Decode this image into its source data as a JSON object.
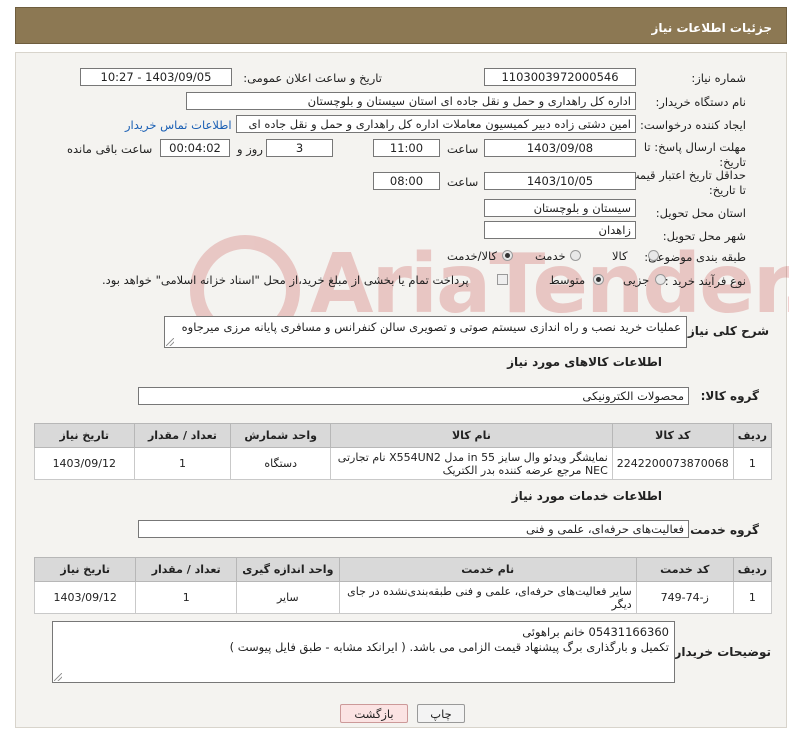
{
  "header": {
    "title": "جزئیات اطلاعات نیاز"
  },
  "form": {
    "need_number_label": "شماره نیاز:",
    "need_number": "1103003972000546",
    "announce_label": "تاریخ و ساعت اعلان عمومی:",
    "announce_value": "1403/09/05 - 10:27",
    "buyer_org_label": "نام دستگاه خریدار:",
    "buyer_org": "اداره کل راهداری و حمل و نقل جاده ای استان سیستان و بلوچستان",
    "creator_label": "ایجاد کننده درخواست:",
    "creator": "امین دشتی زاده دبیر کمیسیون معاملات اداره کل راهداری و حمل و نقل جاده ای",
    "contact_link": "اطلاعات تماس خریدار",
    "reply_deadline_label": "مهلت ارسال پاسخ: تا تاریخ:",
    "reply_date": "1403/09/08",
    "time_label": "ساعت",
    "reply_time": "11:00",
    "days_value": "3",
    "days_label": "روز و",
    "remaining_value": "00:04:02",
    "remaining_label": "ساعت باقی مانده",
    "price_validity_label": "حداقل تاریخ اعتبار قیمت: تا تاریخ:",
    "price_date": "1403/10/05",
    "price_time": "08:00",
    "province_label": "استان محل تحویل:",
    "province": "سیستان و بلوچستان",
    "city_label": "شهر محل تحویل:",
    "city": "زاهدان",
    "category_label": "طبقه بندی موضوعی:",
    "category_options": [
      "کالا",
      "خدمت",
      "کالا/خدمت"
    ],
    "category_selected": "کالا/خدمت",
    "process_label": "نوع فرآیند خرید :",
    "process_options": [
      "جزیی",
      "متوسط"
    ],
    "process_selected": "متوسط",
    "payment_note": "پرداخت تمام یا بخشی از مبلغ خرید،از محل \"اسناد خزانه اسلامی\" خواهد بود."
  },
  "description": {
    "label": "شرح کلی نیاز:",
    "text": "عملیات خرید نصب و راه اندازی سیستم صوتی و تصویری سالن کنفرانس و مسافری پایانه مرزی میرجاوه"
  },
  "goods": {
    "section_title": "اطلاعات کالاهای مورد نیاز",
    "group_label": "گروه کالا:",
    "group_value": "محصولات الکترونیکی",
    "headers": [
      "ردیف",
      "کد کالا",
      "نام کالا",
      "واحد شمارش",
      "تعداد / مقدار",
      "تاریخ نیاز"
    ],
    "rows": [
      {
        "row": "1",
        "code": "2242200073870068",
        "name": "نمایشگر ویدئو وال سایز 55 in مدل X554UN2 نام تجارتی NEC مرجع عرضه کننده بدر الکتریک",
        "unit": "دستگاه",
        "qty": "1",
        "date": "1403/09/12"
      }
    ]
  },
  "services": {
    "section_title": "اطلاعات خدمات مورد نیاز",
    "group_label": "گروه خدمت:",
    "group_value": "فعالیت‌های حرفه‌ای، علمی و فنی",
    "headers": [
      "ردیف",
      "کد خدمت",
      "نام خدمت",
      "واحد اندازه گیری",
      "تعداد / مقدار",
      "تاریخ نیاز"
    ],
    "rows": [
      {
        "row": "1",
        "code": "ز-74-749",
        "name": "سایر فعالیت‌های حرفه‌ای، علمی و فنی طبقه‌بندی‌نشده در جای دیگر",
        "unit": "سایر",
        "qty": "1",
        "date": "1403/09/12"
      }
    ]
  },
  "buyer_notes": {
    "label": "توضیحات خریدار:",
    "line1": "05431166360 خانم براهوئی",
    "line2": "تکمیل و بارگذاری برگ پیشنهاد قیمت الزامی می باشد. ( ایرانکد مشابه - طبق فایل پیوست )"
  },
  "buttons": {
    "print": "چاپ",
    "back": "بازگشت"
  },
  "watermark": "AriaTender.neT",
  "colors": {
    "header_bg": "#8c7853",
    "link": "#1a5fb4",
    "watermark": "#b30000"
  }
}
